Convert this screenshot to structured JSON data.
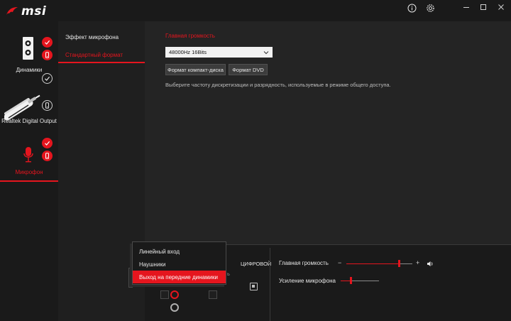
{
  "app": {
    "logo_text": "msi"
  },
  "titlebar": {
    "info_icon": "info-icon",
    "settings_icon": "gear-icon",
    "minimize_icon": "minimize-icon",
    "maximize_icon": "maximize-icon",
    "close_icon": "close-icon"
  },
  "devices": [
    {
      "label": "Динамики",
      "icon": "speaker-icon",
      "default": true,
      "active": false
    },
    {
      "label": "Realtek Digital Output",
      "icon": "optical-cable-icon",
      "default": false,
      "active": false
    },
    {
      "label": "Микрофон",
      "icon": "microphone-icon",
      "default": true,
      "active": true
    }
  ],
  "submenu": {
    "items": [
      {
        "label": "Эффект микрофона",
        "active": false
      },
      {
        "label": "Стандартный формат",
        "active": true
      }
    ]
  },
  "main": {
    "title": "Главная громкость",
    "format_select": {
      "value": "48000Hz 16Bits"
    },
    "cd_button": "Формат компакт-диска",
    "dvd_button": "Формат DVD",
    "hint": "Выберите частоту дискретизации и разрядность, используемые в режиме общего доступа."
  },
  "bottom": {
    "digital_label": "ЦИФРОВОЙ",
    "obscured_label": "ь",
    "master_volume_label": "Главная громкость",
    "master_volume_level": 0.8,
    "mic_boost_label": "Усиление микрофона",
    "mic_boost_level": 0.25,
    "minus": "−",
    "plus": "+"
  },
  "popup": {
    "items": [
      {
        "label": "Линейный вход",
        "selected": false
      },
      {
        "label": "Наушники",
        "selected": false
      },
      {
        "label": "Выход на передние динамики",
        "selected": true
      }
    ]
  },
  "colors": {
    "accent": "#e5151e",
    "background": "#1d1d1d"
  }
}
